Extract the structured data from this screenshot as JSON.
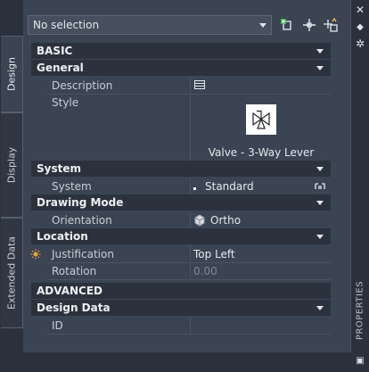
{
  "tabs": [
    "Design",
    "Display",
    "Extended Data"
  ],
  "selection": {
    "value": "No selection"
  },
  "toolbar": [
    "add-selection-icon",
    "pickadd-icon",
    "quick-select-icon"
  ],
  "panel": {
    "title": "PROPERTIES"
  },
  "sections": {
    "basic": "BASIC",
    "advanced": "ADVANCED"
  },
  "categories": {
    "general": "General",
    "system": "System",
    "drawing_mode": "Drawing Mode",
    "location": "Location",
    "design_data": "Design Data"
  },
  "props": {
    "description": {
      "label": "Description",
      "value": ""
    },
    "style": {
      "label": "Style",
      "value": "Valve - 3-Way Lever"
    },
    "system": {
      "label": "System",
      "value": "Standard"
    },
    "orientation": {
      "label": "Orientation",
      "value": "Ortho"
    },
    "justification": {
      "label": "Justification",
      "value": "Top Left"
    },
    "rotation": {
      "label": "Rotation",
      "value": "0.00"
    },
    "id": {
      "label": "ID",
      "value": ""
    }
  }
}
